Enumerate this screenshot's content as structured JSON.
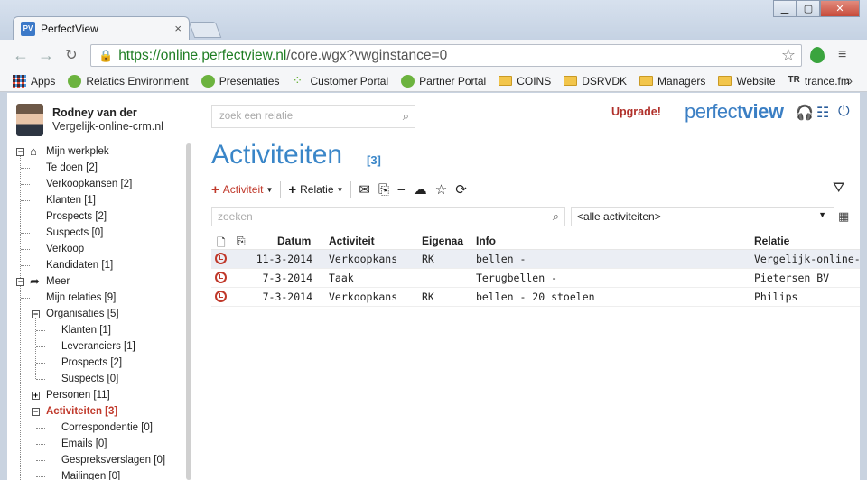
{
  "browser": {
    "tab_title": "PerfectView",
    "tab_favicon": "PV",
    "tab_close": "×",
    "window_controls": {
      "minimize": "▁",
      "maximize": "▢",
      "close": "✕"
    },
    "url_host": "https://online.perfectview.nl",
    "url_path": "/core.wgx?vwginstance=0",
    "bookmarks": [
      {
        "label": "Apps",
        "icon": "apps-icon"
      },
      {
        "label": "Relatics Environment",
        "icon": "green-globe-icon"
      },
      {
        "label": "Presentaties",
        "icon": "green-globe-icon"
      },
      {
        "label": "Customer Portal",
        "icon": "dots-icon"
      },
      {
        "label": "Partner Portal",
        "icon": "green-globe-icon"
      },
      {
        "label": "COINS",
        "icon": "folder-icon"
      },
      {
        "label": "DSRVDK",
        "icon": "folder-icon"
      },
      {
        "label": "Managers",
        "icon": "folder-icon"
      },
      {
        "label": "Website",
        "icon": "folder-icon"
      },
      {
        "label": "trance.fm",
        "icon": "tr-icon"
      }
    ],
    "bookmarks_more": "»"
  },
  "user": {
    "name": "Rodney van der",
    "org": "Vergelijk-online-crm.nl"
  },
  "tree": {
    "mijn_werkplek": "Mijn werkplek",
    "te_doen": "Te doen [2]",
    "verkoopkansen": "Verkoopkansen [2]",
    "klanten": "Klanten [1]",
    "prospects": "Prospects [2]",
    "suspects": "Suspects [0]",
    "verkoop": "Verkoop",
    "kandidaten": "Kandidaten [1]",
    "meer": "Meer",
    "mijn_relaties": "Mijn relaties [9]",
    "organisaties": "Organisaties [5]",
    "org_klanten": "Klanten [1]",
    "org_leveranciers": "Leveranciers [1]",
    "org_prospects": "Prospects [2]",
    "org_suspects": "Suspects [0]",
    "personen": "Personen [11]",
    "activiteiten": "Activiteiten [3]",
    "correspondentie": "Correspondentie [0]",
    "emails": "Emails [0]",
    "gespreksverslagen": "Gespreksverslagen [0]",
    "mailingen": "Mailingen [0]"
  },
  "header": {
    "search_placeholder": "zoek een relatie",
    "upgrade": "Upgrade!",
    "logo_light": "perfect",
    "logo_bold": "view"
  },
  "main": {
    "title": "Activiteiten",
    "count": "[3]",
    "btn_activiteit": "Activiteit",
    "btn_relatie": "Relatie",
    "search_placeholder": "zoeken",
    "filter_value": "<alle activiteiten>"
  },
  "table": {
    "headers": {
      "datum": "Datum",
      "activiteit": "Activiteit",
      "eigenaar": "Eigenaa",
      "info": "Info",
      "relatie": "Relatie"
    },
    "rows": [
      {
        "datum": "11-3-2014",
        "activiteit": "Verkoopkans",
        "eigenaar": "RK",
        "info": "bellen -",
        "relatie": "Vergelijk-online-crm"
      },
      {
        "datum": "7-3-2014",
        "activiteit": "Taak",
        "eigenaar": "",
        "info": "Terugbellen -",
        "relatie": "Pietersen BV"
      },
      {
        "datum": "7-3-2014",
        "activiteit": "Verkoopkans",
        "eigenaar": "RK",
        "info": "bellen - 20 stoelen",
        "relatie": "Philips"
      }
    ]
  },
  "colors": {
    "accent": "#3a86c8",
    "active": "#c0392b",
    "url_green": "#1e7d23"
  }
}
